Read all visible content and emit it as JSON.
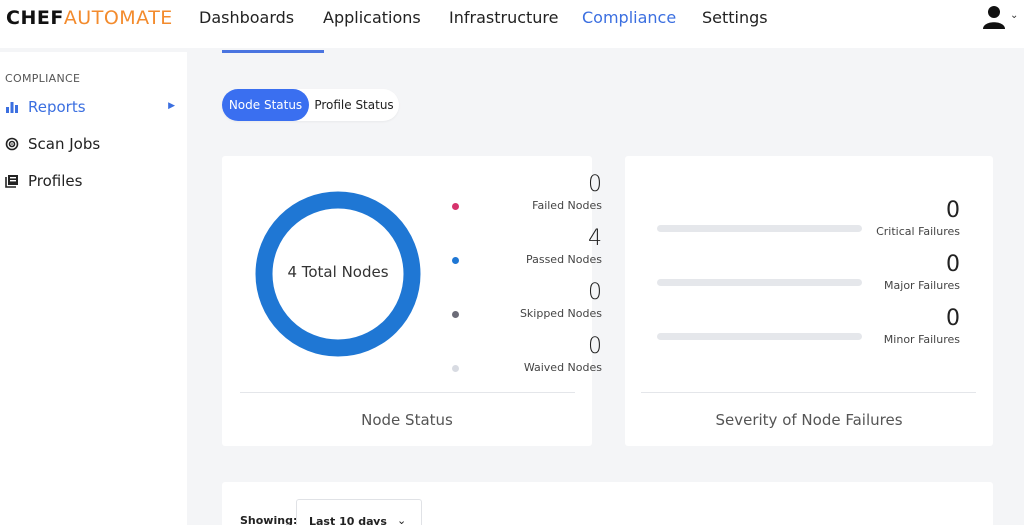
{
  "brand": {
    "part1": "CHEF",
    "part2": "AUTOMATE"
  },
  "nav": {
    "items": [
      "Dashboards",
      "Applications",
      "Infrastructure",
      "Compliance",
      "Settings"
    ],
    "active": "Compliance"
  },
  "sidebar": {
    "heading": "COMPLIANCE",
    "items": [
      {
        "label": "Reports",
        "icon": "bar-chart-icon",
        "active": true
      },
      {
        "label": "Scan Jobs",
        "icon": "radar-icon",
        "active": false
      },
      {
        "label": "Profiles",
        "icon": "profiles-icon",
        "active": false
      }
    ]
  },
  "toggle": {
    "on": "Node Status",
    "off": "Profile Status"
  },
  "node_status": {
    "total_label": "4 Total Nodes",
    "caption": "Node Status",
    "legend": [
      {
        "value": "0",
        "label": "Failed Nodes",
        "color": "#d6336c"
      },
      {
        "value": "4",
        "label": "Passed Nodes",
        "color": "#1f77d4"
      },
      {
        "value": "0",
        "label": "Skipped Nodes",
        "color": "#6c6c78"
      },
      {
        "value": "0",
        "label": "Waived Nodes",
        "color": "#d8dbe2"
      }
    ],
    "donut_color": "#1f77d4"
  },
  "severity": {
    "caption": "Severity of Node Failures",
    "rows": [
      {
        "value": "0",
        "label": "Critical Failures"
      },
      {
        "value": "0",
        "label": "Major Failures"
      },
      {
        "value": "0",
        "label": "Minor Failures"
      }
    ]
  },
  "filter": {
    "showing_label": "Showing:",
    "selected": "Last 10 days"
  }
}
